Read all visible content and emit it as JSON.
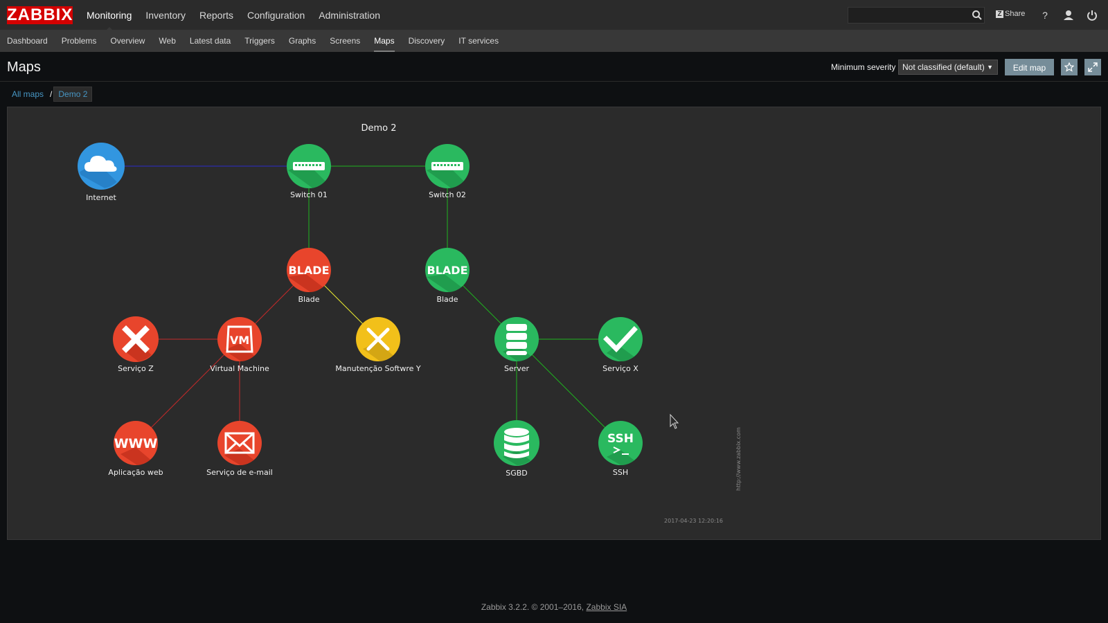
{
  "app": {
    "logo": "ZABBIX"
  },
  "main_nav": [
    {
      "label": "Monitoring",
      "active": true
    },
    {
      "label": "Inventory"
    },
    {
      "label": "Reports"
    },
    {
      "label": "Configuration"
    },
    {
      "label": "Administration"
    }
  ],
  "header_tools": {
    "share_icon_letter": "Z",
    "share_label": "Share",
    "search_value": ""
  },
  "sub_nav": [
    {
      "label": "Dashboard"
    },
    {
      "label": "Problems"
    },
    {
      "label": "Overview"
    },
    {
      "label": "Web"
    },
    {
      "label": "Latest data"
    },
    {
      "label": "Triggers"
    },
    {
      "label": "Graphs"
    },
    {
      "label": "Screens"
    },
    {
      "label": "Maps",
      "active": true
    },
    {
      "label": "Discovery"
    },
    {
      "label": "IT services"
    }
  ],
  "page": {
    "title": "Maps",
    "severity_label": "Minimum severity",
    "severity_value": "Not classified (default)",
    "edit_button": "Edit map"
  },
  "breadcrumb": {
    "root": "All maps",
    "current": "Demo 2"
  },
  "map": {
    "title": "Demo 2",
    "url_watermark": "http://www.zabbix.com",
    "timestamp": "2017-04-23 12:20:16",
    "colors": {
      "green": "#2ab95f",
      "red": "#e8452c",
      "yellow": "#f2c01a",
      "blue": "#3296e0",
      "link_green": "#1fb41f",
      "link_red": "#c42b2b",
      "link_blue": "#2b2bcc",
      "link_yellow": "#e8e830"
    },
    "nodes": [
      {
        "id": "internet",
        "label": "Internet",
        "icon": "cloud-icon",
        "color": "blue"
      },
      {
        "id": "switch01",
        "label": "Switch 01",
        "icon": "switch-icon",
        "color": "green"
      },
      {
        "id": "switch02",
        "label": "Switch 02",
        "icon": "switch-icon",
        "color": "green"
      },
      {
        "id": "blade1",
        "label": "Blade",
        "icon": "blade-icon",
        "icon_text": "BLADE",
        "color": "red"
      },
      {
        "id": "blade2",
        "label": "Blade",
        "icon": "blade-icon",
        "icon_text": "BLADE",
        "color": "green"
      },
      {
        "id": "servicoz",
        "label": "Serviço Z",
        "icon": "cross-icon",
        "color": "red"
      },
      {
        "id": "vm",
        "label": "Virtual Machine",
        "icon": "vm-icon",
        "icon_text": "VM",
        "color": "red"
      },
      {
        "id": "manut",
        "label": "Manutenção Softwre Y",
        "icon": "tools-icon",
        "color": "yellow"
      },
      {
        "id": "server",
        "label": "Server",
        "icon": "server-icon",
        "color": "green"
      },
      {
        "id": "servicox",
        "label": "Serviço X",
        "icon": "check-icon",
        "color": "green"
      },
      {
        "id": "webapp",
        "label": "Aplicação web",
        "icon": "www-icon",
        "icon_text": "WWW",
        "color": "red"
      },
      {
        "id": "email",
        "label": "Serviço de e-mail",
        "icon": "mail-icon",
        "color": "red"
      },
      {
        "id": "sgbd",
        "label": "SGBD",
        "icon": "database-icon",
        "color": "green"
      },
      {
        "id": "ssh",
        "label": "SSH",
        "icon": "ssh-icon",
        "icon_text": "SSH",
        "color": "green"
      }
    ]
  },
  "footer": {
    "text": "Zabbix 3.2.2. © 2001–2016,",
    "link": "Zabbix SIA"
  }
}
